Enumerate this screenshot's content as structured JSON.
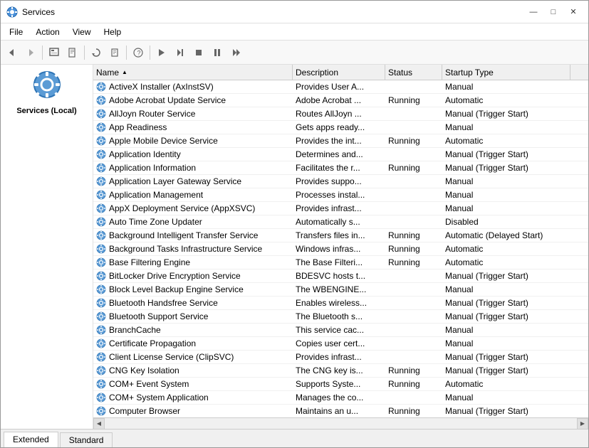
{
  "window": {
    "title": "Services",
    "icon": "⚙"
  },
  "titlebar_controls": {
    "minimize": "—",
    "maximize": "□",
    "close": "✕"
  },
  "menu": {
    "items": [
      "File",
      "Action",
      "View",
      "Help"
    ]
  },
  "toolbar": {
    "buttons": [
      {
        "name": "back-btn",
        "icon": "◀",
        "label": "Back"
      },
      {
        "name": "forward-btn",
        "icon": "▶",
        "label": "Forward"
      },
      {
        "name": "up-btn",
        "icon": "⬆",
        "label": "Up"
      },
      {
        "name": "show-hide-btn",
        "icon": "⬜",
        "label": "Show/Hide"
      },
      {
        "name": "export-btn",
        "icon": "📄",
        "label": "Export"
      },
      {
        "name": "refresh-btn",
        "icon": "↺",
        "label": "Refresh"
      },
      {
        "name": "properties-btn",
        "icon": "⚙",
        "label": "Properties"
      },
      {
        "name": "help-btn",
        "icon": "?",
        "label": "Help"
      },
      {
        "name": "play-btn",
        "icon": "▶",
        "label": "Play"
      },
      {
        "name": "play2-btn",
        "icon": "▶▶",
        "label": "Resume"
      },
      {
        "name": "stop-btn",
        "icon": "■",
        "label": "Stop"
      },
      {
        "name": "pause-btn",
        "icon": "⏸",
        "label": "Pause"
      },
      {
        "name": "restart-btn",
        "icon": "⏭",
        "label": "Restart"
      }
    ]
  },
  "left_panel": {
    "icon": "⚙",
    "label": "Services (Local)"
  },
  "columns": [
    {
      "key": "name",
      "label": "Name",
      "sort": "asc"
    },
    {
      "key": "description",
      "label": "Description"
    },
    {
      "key": "status",
      "label": "Status"
    },
    {
      "key": "startup",
      "label": "Startup Type"
    }
  ],
  "services": [
    {
      "name": "ActiveX Installer (AxInstSV)",
      "description": "Provides User A...",
      "status": "",
      "startup": "Manual"
    },
    {
      "name": "Adobe Acrobat Update Service",
      "description": "Adobe Acrobat ...",
      "status": "Running",
      "startup": "Automatic"
    },
    {
      "name": "AllJoyn Router Service",
      "description": "Routes AllJoyn ...",
      "status": "",
      "startup": "Manual (Trigger Start)"
    },
    {
      "name": "App Readiness",
      "description": "Gets apps ready...",
      "status": "",
      "startup": "Manual"
    },
    {
      "name": "Apple Mobile Device Service",
      "description": "Provides the int...",
      "status": "Running",
      "startup": "Automatic"
    },
    {
      "name": "Application Identity",
      "description": "Determines and...",
      "status": "",
      "startup": "Manual (Trigger Start)"
    },
    {
      "name": "Application Information",
      "description": "Facilitates the r...",
      "status": "Running",
      "startup": "Manual (Trigger Start)"
    },
    {
      "name": "Application Layer Gateway Service",
      "description": "Provides suppo...",
      "status": "",
      "startup": "Manual"
    },
    {
      "name": "Application Management",
      "description": "Processes instal...",
      "status": "",
      "startup": "Manual"
    },
    {
      "name": "AppX Deployment Service (AppXSVC)",
      "description": "Provides infrast...",
      "status": "",
      "startup": "Manual"
    },
    {
      "name": "Auto Time Zone Updater",
      "description": "Automatically s...",
      "status": "",
      "startup": "Disabled"
    },
    {
      "name": "Background Intelligent Transfer Service",
      "description": "Transfers files in...",
      "status": "Running",
      "startup": "Automatic (Delayed Start)"
    },
    {
      "name": "Background Tasks Infrastructure Service",
      "description": "Windows infras...",
      "status": "Running",
      "startup": "Automatic"
    },
    {
      "name": "Base Filtering Engine",
      "description": "The Base Filteri...",
      "status": "Running",
      "startup": "Automatic"
    },
    {
      "name": "BitLocker Drive Encryption Service",
      "description": "BDESVC hosts t...",
      "status": "",
      "startup": "Manual (Trigger Start)"
    },
    {
      "name": "Block Level Backup Engine Service",
      "description": "The WBENGINE...",
      "status": "",
      "startup": "Manual"
    },
    {
      "name": "Bluetooth Handsfree Service",
      "description": "Enables wireless...",
      "status": "",
      "startup": "Manual (Trigger Start)"
    },
    {
      "name": "Bluetooth Support Service",
      "description": "The Bluetooth s...",
      "status": "",
      "startup": "Manual (Trigger Start)"
    },
    {
      "name": "BranchCache",
      "description": "This service cac...",
      "status": "",
      "startup": "Manual"
    },
    {
      "name": "Certificate Propagation",
      "description": "Copies user cert...",
      "status": "",
      "startup": "Manual"
    },
    {
      "name": "Client License Service (ClipSVC)",
      "description": "Provides infrast...",
      "status": "",
      "startup": "Manual (Trigger Start)"
    },
    {
      "name": "CNG Key Isolation",
      "description": "The CNG key is...",
      "status": "Running",
      "startup": "Manual (Trigger Start)"
    },
    {
      "name": "COM+ Event System",
      "description": "Supports Syste...",
      "status": "Running",
      "startup": "Automatic"
    },
    {
      "name": "COM+ System Application",
      "description": "Manages the co...",
      "status": "",
      "startup": "Manual"
    },
    {
      "name": "Computer Browser",
      "description": "Maintains an u...",
      "status": "Running",
      "startup": "Manual (Trigger Start)"
    }
  ],
  "tabs": [
    {
      "label": "Extended",
      "active": true
    },
    {
      "label": "Standard",
      "active": false
    }
  ],
  "status_bar": {
    "text": ""
  }
}
